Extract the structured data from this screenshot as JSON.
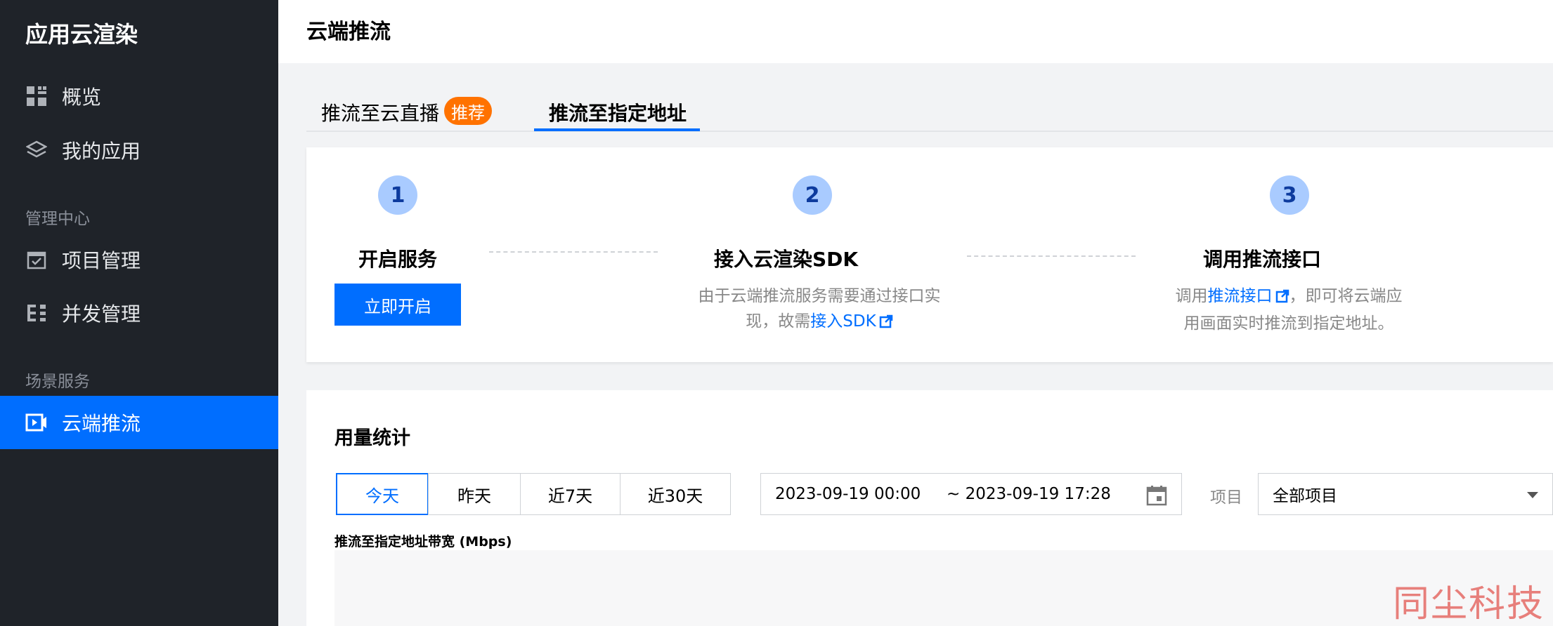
{
  "sidebar": {
    "app_title": "应用云渲染",
    "items": [
      {
        "label": "概览",
        "icon": "dashboard-grid-icon"
      },
      {
        "label": "我的应用",
        "icon": "layers-icon"
      }
    ],
    "group_manage": {
      "heading": "管理中心",
      "items": [
        {
          "label": "项目管理",
          "icon": "calendar-check-icon"
        },
        {
          "label": "并发管理",
          "icon": "list-bars-icon"
        }
      ]
    },
    "group_scene": {
      "heading": "场景服务",
      "items": [
        {
          "label": "云端推流",
          "icon": "video-camera-icon",
          "active": true
        }
      ]
    }
  },
  "header": {
    "title": "云端推流"
  },
  "tabs": [
    {
      "label": "推流至云直播",
      "badge": "推荐",
      "active": false
    },
    {
      "label": "推流至指定地址",
      "active": true
    }
  ],
  "steps": [
    {
      "number": "1",
      "title": "开启服务",
      "button": "立即开启"
    },
    {
      "number": "2",
      "title": "接入云渲染SDK",
      "desc_line1": "由于云端推流服务需要通过接口实",
      "desc_line2_prefix": "现，故需",
      "desc_link": "接入SDK"
    },
    {
      "number": "3",
      "title": "调用推流接口",
      "desc_line1_prefix": "调用",
      "desc_link": "推流接口",
      "desc_line1_suffix": "，即可将云端应",
      "desc_line2": "用画面实时推流到指定地址。"
    }
  ],
  "usage": {
    "title": "用量统计",
    "ranges": [
      {
        "label": "今天",
        "active": true
      },
      {
        "label": "昨天"
      },
      {
        "label": "近7天"
      },
      {
        "label": "近30天"
      }
    ],
    "date_start": "2023-09-19 00:00",
    "date_end": "~ 2023-09-19 17:28",
    "project_label": "项目",
    "project_value": "全部项目",
    "chart_title": "推流至指定地址带宽 (Mbps)"
  },
  "watermark": "同尘科技",
  "colors": {
    "accent": "#006eff",
    "sidebar_bg": "#1f2329",
    "badge": "#ff7200",
    "step_circle": "#a9cbff"
  }
}
